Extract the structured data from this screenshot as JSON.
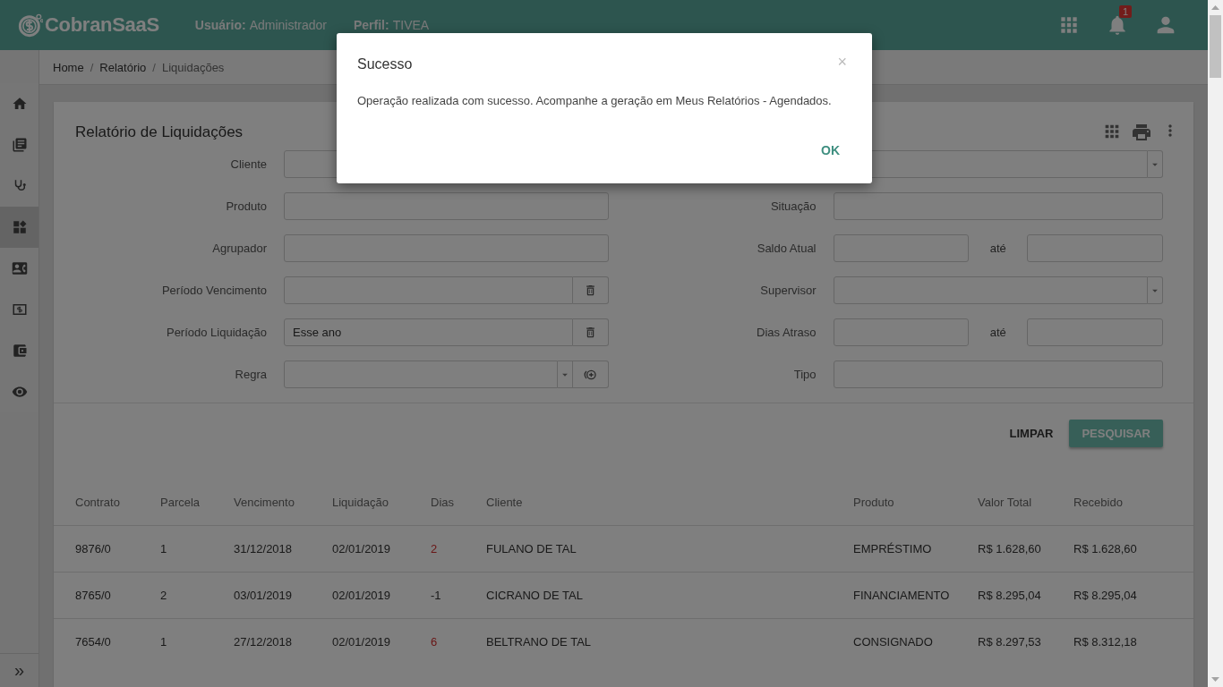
{
  "header": {
    "logo": "CobranSaaS",
    "user_label": "Usuário:",
    "user": "Administrador",
    "profile_label": "Perfil:",
    "profile": "TIVEA",
    "notification_count": "1"
  },
  "sidebar": {
    "items": [
      {
        "kind": "home",
        "selected": false
      },
      {
        "kind": "library",
        "selected": false
      },
      {
        "kind": "stethoscope",
        "selected": false
      },
      {
        "kind": "dashboard",
        "selected": true
      },
      {
        "kind": "contact",
        "selected": false
      },
      {
        "kind": "money",
        "selected": false
      },
      {
        "kind": "wallet",
        "selected": false
      },
      {
        "kind": "eye",
        "selected": false
      }
    ],
    "expand": "»"
  },
  "breadcrumb": {
    "items": [
      "Home",
      "Relatório",
      "Liquidações"
    ],
    "separator": "/"
  },
  "report": {
    "title": "Relatório de Liquidações",
    "filters_left": [
      {
        "label": "Cliente",
        "kind": "text"
      },
      {
        "label": "Produto",
        "kind": "text"
      },
      {
        "label": "Agrupador",
        "kind": "text"
      },
      {
        "label": "Período Vencimento",
        "kind": "date"
      },
      {
        "label": "Período Liquidação",
        "kind": "date",
        "value": "Esse ano"
      },
      {
        "label": "Regra",
        "kind": "select-add"
      }
    ],
    "filters_right": [
      {
        "kind": "select"
      },
      {
        "label": "Situação",
        "kind": "text"
      },
      {
        "label": "Saldo Atual",
        "kind": "range",
        "separator": "até"
      },
      {
        "label": "Supervisor",
        "kind": "select"
      },
      {
        "label": "Dias Atraso",
        "kind": "range",
        "separator": "até"
      },
      {
        "label": "Tipo",
        "kind": "text"
      }
    ],
    "buttons": [
      {
        "label": "LIMPAR",
        "kind": "flat"
      },
      {
        "label": "PESQUISAR",
        "kind": "primary"
      }
    ]
  },
  "table": {
    "columns": [
      "Contrato",
      "Parcela",
      "Vencimento",
      "Liquidação",
      "Dias",
      "Cliente",
      "Produto",
      "Valor Total",
      "Recebido"
    ],
    "rows": [
      {
        "cells": [
          "9876/0",
          "1",
          "31/12/2018",
          "02/01/2019",
          "2",
          "FULANO DE TAL",
          "EMPRÉSTIMO",
          "R$ 1.628,60",
          "R$ 1.628,60"
        ],
        "late": true
      },
      {
        "cells": [
          "8765/0",
          "2",
          "03/01/2019",
          "02/01/2019",
          "-1",
          "CICRANO DE TAL",
          "FINANCIAMENTO",
          "R$ 8.295,04",
          "R$ 8.295,04"
        ],
        "late": false
      },
      {
        "cells": [
          "7654/0",
          "1",
          "27/12/2018",
          "02/01/2019",
          "6",
          "BELTRANO DE TAL",
          "CONSIGNADO",
          "R$ 8.297,53",
          "R$ 8.312,18"
        ],
        "late": true
      }
    ]
  },
  "dialog": {
    "title": "Sucesso",
    "close": "×",
    "message": "Operação realizada com sucesso. Acompanhe a geração em Meus Relatórios - Agendados.",
    "button": "OK"
  }
}
